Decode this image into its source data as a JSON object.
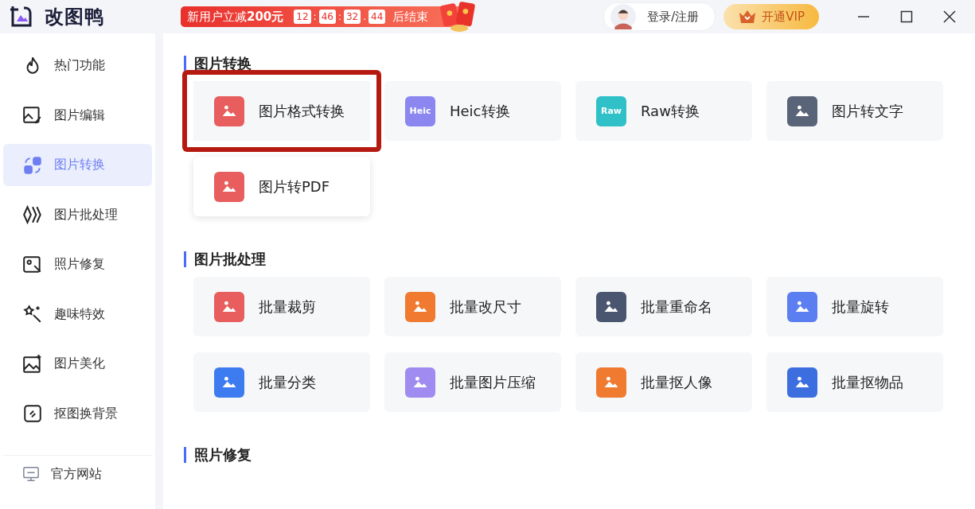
{
  "app": {
    "name": "改图鸭"
  },
  "promo": {
    "text": "新用户立减",
    "amount": "200元",
    "countdown": [
      "12",
      "46",
      "32",
      "44"
    ],
    "separators": [
      ":",
      ":",
      "."
    ],
    "suffix": "后结束"
  },
  "login": {
    "label": "登录/注册"
  },
  "vip": {
    "label": "开通VIP"
  },
  "sidebar": {
    "items": [
      {
        "label": "热门功能",
        "kind": "flame",
        "selected": false
      },
      {
        "label": "图片编辑",
        "kind": "edit",
        "selected": false
      },
      {
        "label": "图片转换",
        "kind": "convert",
        "selected": true
      },
      {
        "label": "图片批处理",
        "kind": "batch",
        "selected": false
      },
      {
        "label": "照片修复",
        "kind": "repair",
        "selected": false
      },
      {
        "label": "趣味特效",
        "kind": "magic",
        "selected": false
      },
      {
        "label": "图片美化",
        "kind": "beautify",
        "selected": false
      },
      {
        "label": "抠图换背景",
        "kind": "cutout",
        "selected": false
      }
    ],
    "footer": {
      "label": "官方网站"
    }
  },
  "sections": [
    {
      "title": "图片转换",
      "tools": [
        {
          "label": "图片格式转换",
          "color": "#e85d5d",
          "highlighted": true,
          "raised": false
        },
        {
          "label": "Heic转换",
          "color": "#8b86f0",
          "badge": "Heic",
          "highlighted": false,
          "raised": false
        },
        {
          "label": "Raw转换",
          "color": "#2fc0c8",
          "badge": "Raw",
          "highlighted": false,
          "raised": false
        },
        {
          "label": "图片转文字",
          "color": "#5a6478",
          "highlighted": false,
          "raised": false
        },
        {
          "label": "图片转PDF",
          "color": "#e85d5d",
          "highlighted": false,
          "raised": true
        }
      ]
    },
    {
      "title": "图片批处理",
      "tools": [
        {
          "label": "批量裁剪",
          "color": "#e85d5d",
          "highlighted": false,
          "raised": false
        },
        {
          "label": "批量改尺寸",
          "color": "#f07a30",
          "highlighted": false,
          "raised": false
        },
        {
          "label": "批量重命名",
          "color": "#4a5570",
          "highlighted": false,
          "raised": false
        },
        {
          "label": "批量旋转",
          "color": "#5b7ff0",
          "highlighted": false,
          "raised": false
        },
        {
          "label": "批量分类",
          "color": "#3d7cf0",
          "highlighted": false,
          "raised": false
        },
        {
          "label": "批量图片压缩",
          "color": "#a08cf0",
          "highlighted": false,
          "raised": false
        },
        {
          "label": "批量抠人像",
          "color": "#f07a30",
          "highlighted": false,
          "raised": false
        },
        {
          "label": "批量抠物品",
          "color": "#3d6ee0",
          "highlighted": false,
          "raised": false
        }
      ]
    },
    {
      "title": "照片修复"
    }
  ]
}
